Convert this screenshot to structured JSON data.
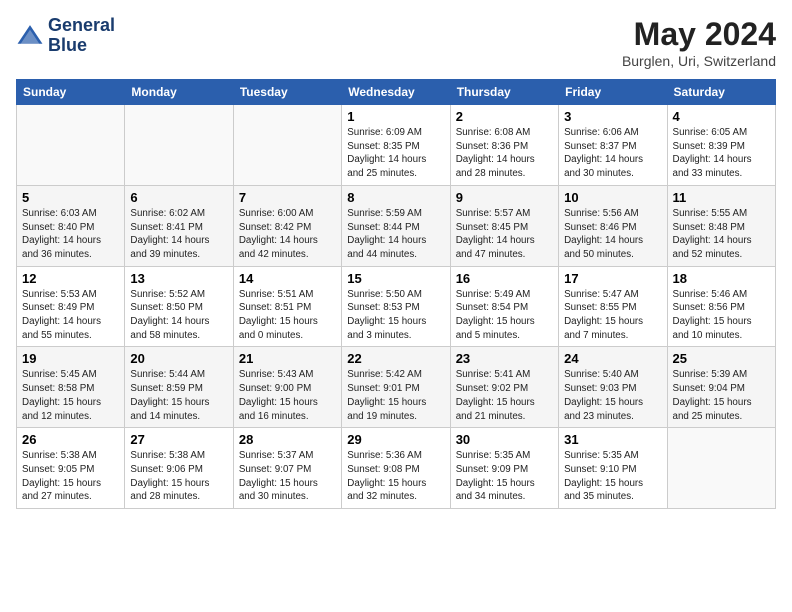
{
  "header": {
    "logo_line1": "General",
    "logo_line2": "Blue",
    "month_year": "May 2024",
    "location": "Burglen, Uri, Switzerland"
  },
  "weekdays": [
    "Sunday",
    "Monday",
    "Tuesday",
    "Wednesday",
    "Thursday",
    "Friday",
    "Saturday"
  ],
  "weeks": [
    [
      {
        "num": "",
        "info": ""
      },
      {
        "num": "",
        "info": ""
      },
      {
        "num": "",
        "info": ""
      },
      {
        "num": "1",
        "info": "Sunrise: 6:09 AM\nSunset: 8:35 PM\nDaylight: 14 hours\nand 25 minutes."
      },
      {
        "num": "2",
        "info": "Sunrise: 6:08 AM\nSunset: 8:36 PM\nDaylight: 14 hours\nand 28 minutes."
      },
      {
        "num": "3",
        "info": "Sunrise: 6:06 AM\nSunset: 8:37 PM\nDaylight: 14 hours\nand 30 minutes."
      },
      {
        "num": "4",
        "info": "Sunrise: 6:05 AM\nSunset: 8:39 PM\nDaylight: 14 hours\nand 33 minutes."
      }
    ],
    [
      {
        "num": "5",
        "info": "Sunrise: 6:03 AM\nSunset: 8:40 PM\nDaylight: 14 hours\nand 36 minutes."
      },
      {
        "num": "6",
        "info": "Sunrise: 6:02 AM\nSunset: 8:41 PM\nDaylight: 14 hours\nand 39 minutes."
      },
      {
        "num": "7",
        "info": "Sunrise: 6:00 AM\nSunset: 8:42 PM\nDaylight: 14 hours\nand 42 minutes."
      },
      {
        "num": "8",
        "info": "Sunrise: 5:59 AM\nSunset: 8:44 PM\nDaylight: 14 hours\nand 44 minutes."
      },
      {
        "num": "9",
        "info": "Sunrise: 5:57 AM\nSunset: 8:45 PM\nDaylight: 14 hours\nand 47 minutes."
      },
      {
        "num": "10",
        "info": "Sunrise: 5:56 AM\nSunset: 8:46 PM\nDaylight: 14 hours\nand 50 minutes."
      },
      {
        "num": "11",
        "info": "Sunrise: 5:55 AM\nSunset: 8:48 PM\nDaylight: 14 hours\nand 52 minutes."
      }
    ],
    [
      {
        "num": "12",
        "info": "Sunrise: 5:53 AM\nSunset: 8:49 PM\nDaylight: 14 hours\nand 55 minutes."
      },
      {
        "num": "13",
        "info": "Sunrise: 5:52 AM\nSunset: 8:50 PM\nDaylight: 14 hours\nand 58 minutes."
      },
      {
        "num": "14",
        "info": "Sunrise: 5:51 AM\nSunset: 8:51 PM\nDaylight: 15 hours\nand 0 minutes."
      },
      {
        "num": "15",
        "info": "Sunrise: 5:50 AM\nSunset: 8:53 PM\nDaylight: 15 hours\nand 3 minutes."
      },
      {
        "num": "16",
        "info": "Sunrise: 5:49 AM\nSunset: 8:54 PM\nDaylight: 15 hours\nand 5 minutes."
      },
      {
        "num": "17",
        "info": "Sunrise: 5:47 AM\nSunset: 8:55 PM\nDaylight: 15 hours\nand 7 minutes."
      },
      {
        "num": "18",
        "info": "Sunrise: 5:46 AM\nSunset: 8:56 PM\nDaylight: 15 hours\nand 10 minutes."
      }
    ],
    [
      {
        "num": "19",
        "info": "Sunrise: 5:45 AM\nSunset: 8:58 PM\nDaylight: 15 hours\nand 12 minutes."
      },
      {
        "num": "20",
        "info": "Sunrise: 5:44 AM\nSunset: 8:59 PM\nDaylight: 15 hours\nand 14 minutes."
      },
      {
        "num": "21",
        "info": "Sunrise: 5:43 AM\nSunset: 9:00 PM\nDaylight: 15 hours\nand 16 minutes."
      },
      {
        "num": "22",
        "info": "Sunrise: 5:42 AM\nSunset: 9:01 PM\nDaylight: 15 hours\nand 19 minutes."
      },
      {
        "num": "23",
        "info": "Sunrise: 5:41 AM\nSunset: 9:02 PM\nDaylight: 15 hours\nand 21 minutes."
      },
      {
        "num": "24",
        "info": "Sunrise: 5:40 AM\nSunset: 9:03 PM\nDaylight: 15 hours\nand 23 minutes."
      },
      {
        "num": "25",
        "info": "Sunrise: 5:39 AM\nSunset: 9:04 PM\nDaylight: 15 hours\nand 25 minutes."
      }
    ],
    [
      {
        "num": "26",
        "info": "Sunrise: 5:38 AM\nSunset: 9:05 PM\nDaylight: 15 hours\nand 27 minutes."
      },
      {
        "num": "27",
        "info": "Sunrise: 5:38 AM\nSunset: 9:06 PM\nDaylight: 15 hours\nand 28 minutes."
      },
      {
        "num": "28",
        "info": "Sunrise: 5:37 AM\nSunset: 9:07 PM\nDaylight: 15 hours\nand 30 minutes."
      },
      {
        "num": "29",
        "info": "Sunrise: 5:36 AM\nSunset: 9:08 PM\nDaylight: 15 hours\nand 32 minutes."
      },
      {
        "num": "30",
        "info": "Sunrise: 5:35 AM\nSunset: 9:09 PM\nDaylight: 15 hours\nand 34 minutes."
      },
      {
        "num": "31",
        "info": "Sunrise: 5:35 AM\nSunset: 9:10 PM\nDaylight: 15 hours\nand 35 minutes."
      },
      {
        "num": "",
        "info": ""
      }
    ]
  ]
}
